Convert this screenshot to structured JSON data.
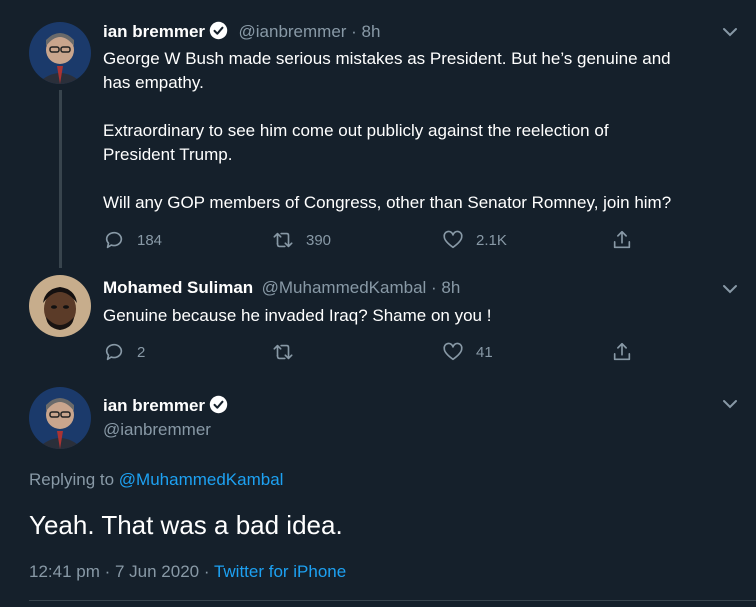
{
  "colors": {
    "background": "#15202b",
    "text": "#ffffff",
    "secondary": "#8899a6",
    "accent": "#1da1f2",
    "divider": "#38444d"
  },
  "tweets": [
    {
      "name": "ian bremmer",
      "verified": true,
      "handle": "@ianbremmer · 8h",
      "lines": [
        "George W Bush made serious mistakes as President. But he’s genuine and",
        "has empathy.",
        "Extraordinary to see him come out publicly against the reelection of",
        "President Trump.",
        "Will any GOP members of Congress, other than Senator Romney, join him?"
      ],
      "actions": {
        "replies": "184",
        "retweets": "390",
        "likes": "2.1K"
      }
    },
    {
      "name": "Mohamed Suliman",
      "verified": false,
      "handle": "@MuhammedKambal · 8h",
      "lines": [
        "Genuine because he invaded Iraq? Shame on you !"
      ],
      "actions": {
        "replies": "2",
        "retweets": "",
        "likes": "41"
      }
    }
  ],
  "main": {
    "name": "ian bremmer",
    "handle": "@ianbremmer",
    "replying_prefix": "Replying to",
    "replying_to": "@MuhammedKambal",
    "text": "Yeah. That was a bad idea.",
    "timestamp": "12:41 pm · 7 Jun 2020 ·",
    "source": "Twitter for iPhone"
  },
  "icons": [
    "reply-icon",
    "retweet-icon",
    "like-icon",
    "share-icon",
    "chevron-down-icon",
    "verified-badge-icon"
  ]
}
